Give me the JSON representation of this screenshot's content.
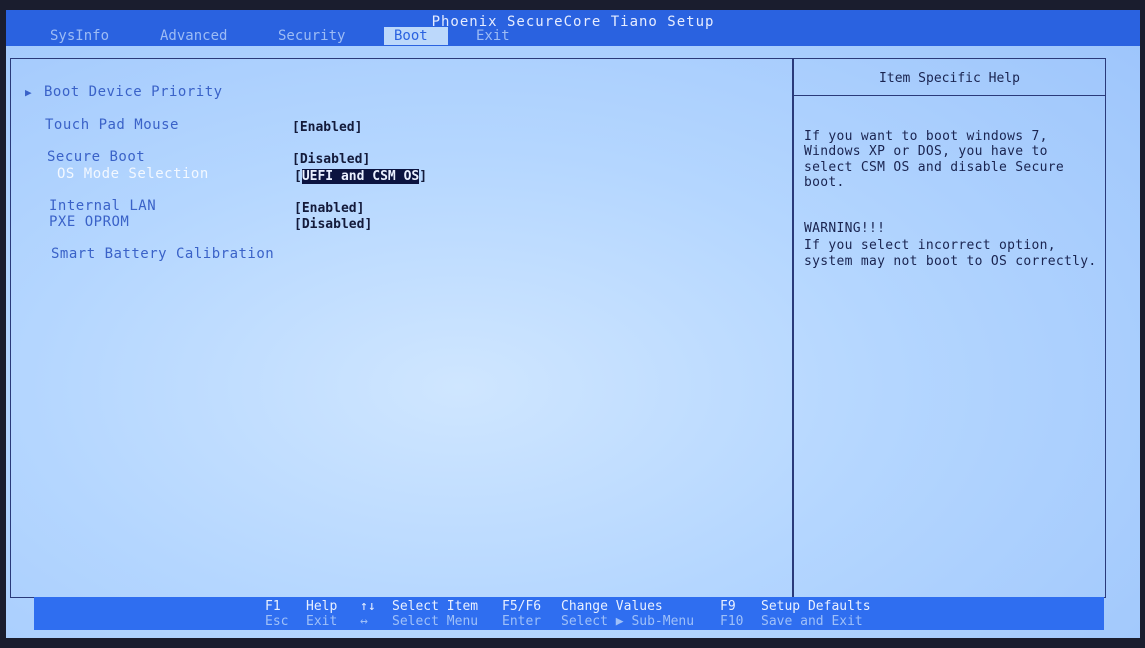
{
  "app_title": "Phoenix SecureCore Tiano Setup",
  "menu": {
    "tabs": [
      "SysInfo",
      "Advanced",
      "Security",
      "Boot",
      "Exit"
    ],
    "active": "Boot"
  },
  "boot": {
    "boot_device_priority": "Boot Device Priority",
    "touch_pad_mouse": {
      "label": "Touch Pad Mouse",
      "value": "[Enabled]"
    },
    "secure_boot": {
      "label": "Secure Boot",
      "value": "[Disabled]"
    },
    "os_mode": {
      "label": "OS Mode Selection",
      "bracket_open": "[",
      "value": "UEFI and CSM OS",
      "bracket_close": "]"
    },
    "internal_lan": {
      "label": "Internal LAN",
      "value": "[Enabled]"
    },
    "pxe_oprom": {
      "label": "PXE OPROM",
      "value": "[Disabled]"
    },
    "smart_battery": "Smart Battery Calibration"
  },
  "help": {
    "title": "Item Specific Help",
    "lines": [
      "If you want to boot windows 7,",
      "Windows XP or DOS, you have to",
      "select CSM OS and disable Secure",
      "boot.",
      "WARNING!!!",
      "If you select incorrect option,",
      "system may not boot to OS correctly."
    ]
  },
  "footer": {
    "row1": [
      {
        "key": "F1",
        "label": "Help"
      },
      {
        "key": "↑↓",
        "label": "Select Item"
      },
      {
        "key": "F5/F6",
        "label": "Change Values"
      },
      {
        "key": "F9",
        "label": "Setup Defaults"
      }
    ],
    "row2": [
      {
        "key": "Esc",
        "label": "Exit"
      },
      {
        "key": "↔",
        "label": "Select Menu"
      },
      {
        "key": "Enter",
        "label": "Select ▶ Sub-Menu"
      },
      {
        "key": "F10",
        "label": "Save and Exit"
      }
    ]
  },
  "colors": {
    "screen_bg": "#b4d6ff",
    "top_bar": "#2a62e0",
    "label_blue": "#3a62c8",
    "selected_bg": "#0c1440"
  }
}
